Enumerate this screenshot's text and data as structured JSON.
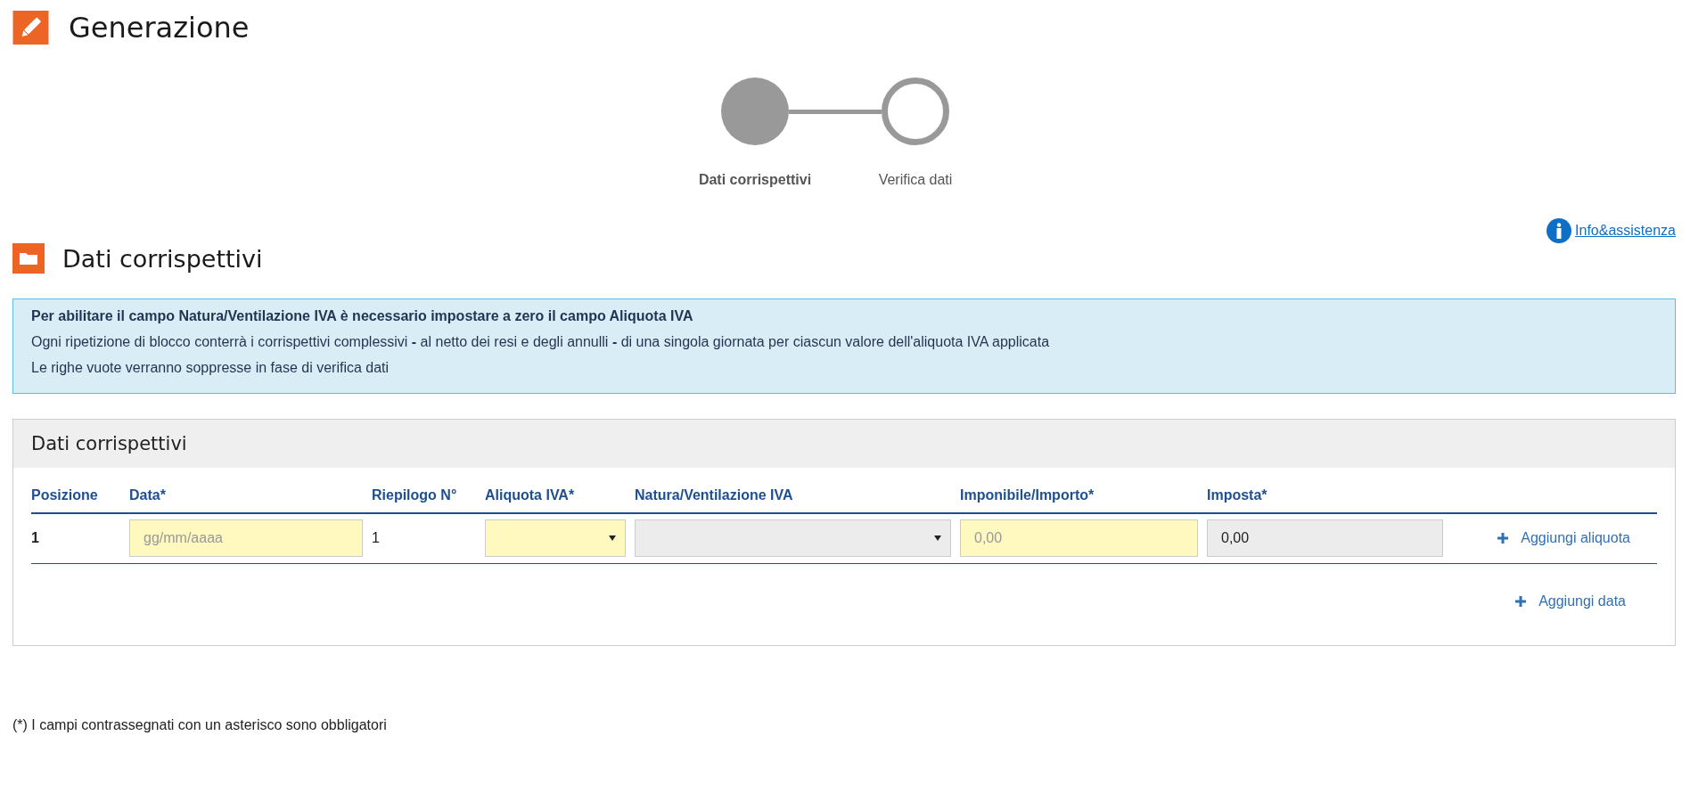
{
  "page_title": "Generazione",
  "steps": [
    {
      "label": "Dati corrispettivi",
      "selected": true
    },
    {
      "label": "Verifica dati",
      "selected": false
    }
  ],
  "help_link": "Info&assistenza",
  "section_title": "Dati corrispettivi",
  "alert": [
    "**Per abilitare il campo Natura/Ventilazione IVA è necessario impostare a zero il campo Aliquota IVA**",
    "Ogni ripetizione di blocco conterrà i corrispettivi complessivi **-** al netto dei resi e degli annulli **-** di una singola giornata per ciascun valore dell'aliquota IVA applicata",
    "Le righe vuote verranno soppresse in fase di verifica dati"
  ],
  "panel": {
    "title": "Dati corrispettivi",
    "columns": [
      "Posizione",
      "Data*",
      "Riepilogo N°",
      "Aliquota IVA*",
      "Natura/Ventilazione IVA",
      "Imponibile/Importo*",
      "Imposta*"
    ],
    "rows": [
      {
        "cells": [
          {
            "kind": "text",
            "text": "1"
          },
          {
            "kind": "input",
            "placeholder": "gg/mm/aaaa",
            "disabled": false
          },
          {
            "kind": "plain",
            "text": "1"
          },
          {
            "kind": "select",
            "disabled": false
          },
          {
            "kind": "select",
            "disabled": true
          },
          {
            "kind": "input",
            "placeholder": "0,00",
            "disabled": false
          },
          {
            "kind": "input",
            "value": "0,00",
            "disabled": true
          }
        ],
        "action": "Aggiungi aliquota"
      }
    ],
    "add_date": "Aggiungi data"
  },
  "footnote": "(*) I campi contrassegnati con un asterisco sono obbligatori"
}
